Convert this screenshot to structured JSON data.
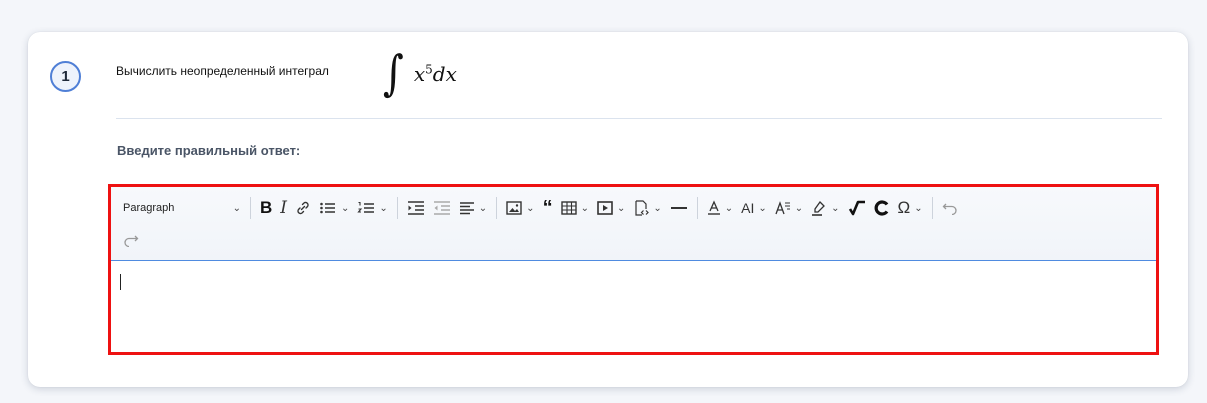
{
  "question": {
    "number": "1",
    "text": "Вычислить неопределенный интеграл",
    "formula": {
      "integral_sign": "∫",
      "base": "x",
      "exponent": "5",
      "differential": "dx"
    }
  },
  "answer_prompt": "Введите правильный ответ:",
  "editor": {
    "paragraph_select": "Paragraph",
    "content": "",
    "accent_color": "#ee1111",
    "toolbar_icons": [
      "bold-icon",
      "italic-icon",
      "link-icon",
      "bulleted-list-icon",
      "numbered-list-icon",
      "indent-icon",
      "outdent-icon",
      "align-icon",
      "image-icon",
      "blockquote-icon",
      "table-icon",
      "media-icon",
      "html-embed-icon",
      "horizontal-line-icon",
      "font-color-icon",
      "font-size-icon",
      "font-family-icon",
      "highlight-icon",
      "math-icon",
      "chemistry-icon",
      "special-characters-icon",
      "undo-icon",
      "redo-icon"
    ]
  }
}
